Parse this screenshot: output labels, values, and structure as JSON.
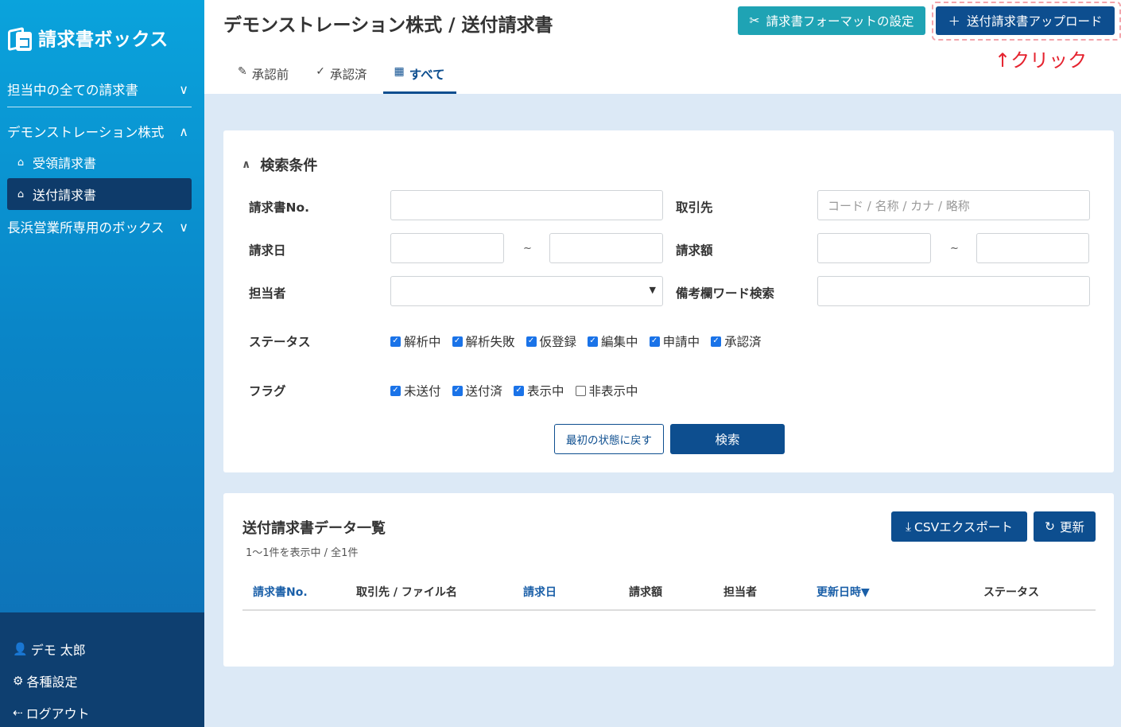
{
  "sidebar": {
    "logo": "請求書ボックス",
    "groups": [
      {
        "label": "担当中の全ての請求書",
        "expanded": false
      },
      {
        "label": "デモンストレーション株式",
        "expanded": true
      },
      {
        "label": "長浜営業所専用のボックス",
        "expanded": false
      }
    ],
    "items": [
      {
        "label": "受領請求書",
        "icon": "inbox-icon"
      },
      {
        "label": "送付請求書",
        "icon": "inbox-icon",
        "active": true
      }
    ],
    "bottom": [
      {
        "label": "デモ 太郎",
        "icon": "user-icon"
      },
      {
        "label": "各種設定",
        "icon": "gear-icon"
      },
      {
        "label": "ログアウト",
        "icon": "logout-icon"
      }
    ]
  },
  "header": {
    "title": "デモンストレーション株式 / 送付請求書",
    "format_button": "請求書フォーマットの設定",
    "upload_button": "送付請求書アップロード",
    "click_hint": "↑クリック"
  },
  "tabs": [
    {
      "label": "承認前",
      "icon": "edit-icon"
    },
    {
      "label": "承認済",
      "icon": "check-circle-icon"
    },
    {
      "label": "すべて",
      "icon": "grid-icon",
      "active": true
    }
  ],
  "search": {
    "title": "検索条件",
    "invoice_no_label": "請求書No.",
    "client_label": "取引先",
    "client_placeholder": "コード / 名称 / カナ / 略称",
    "date_label": "請求日",
    "amount_label": "請求額",
    "range_sep": "~",
    "assignee_label": "担当者",
    "memo_label": "備考欄ワード検索",
    "status_label": "ステータス",
    "status_options": [
      {
        "label": "解析中",
        "checked": true
      },
      {
        "label": "解析失敗",
        "checked": true
      },
      {
        "label": "仮登録",
        "checked": true
      },
      {
        "label": "編集中",
        "checked": true
      },
      {
        "label": "申請中",
        "checked": true
      },
      {
        "label": "承認済",
        "checked": true
      }
    ],
    "flag_label": "フラグ",
    "flag_options": [
      {
        "label": "未送付",
        "checked": true
      },
      {
        "label": "送付済",
        "checked": true
      },
      {
        "label": "表示中",
        "checked": true
      },
      {
        "label": "非表示中",
        "checked": false
      }
    ],
    "reset_button": "最初の状態に戻す",
    "search_button": "検索"
  },
  "list": {
    "title": "送付請求書データ一覧",
    "count": "1〜1件を表示中 / 全1件",
    "csv_button": "CSVエクスポート",
    "refresh_button": "更新",
    "columns": [
      "請求書No.",
      "取引先 / ファイル名",
      "請求日",
      "請求額",
      "担当者",
      "更新日時▼",
      "ステータス"
    ]
  },
  "colors": {
    "primary": "#0d4e8f",
    "teal": "#1fa3b4",
    "hint": "#e5232f"
  }
}
